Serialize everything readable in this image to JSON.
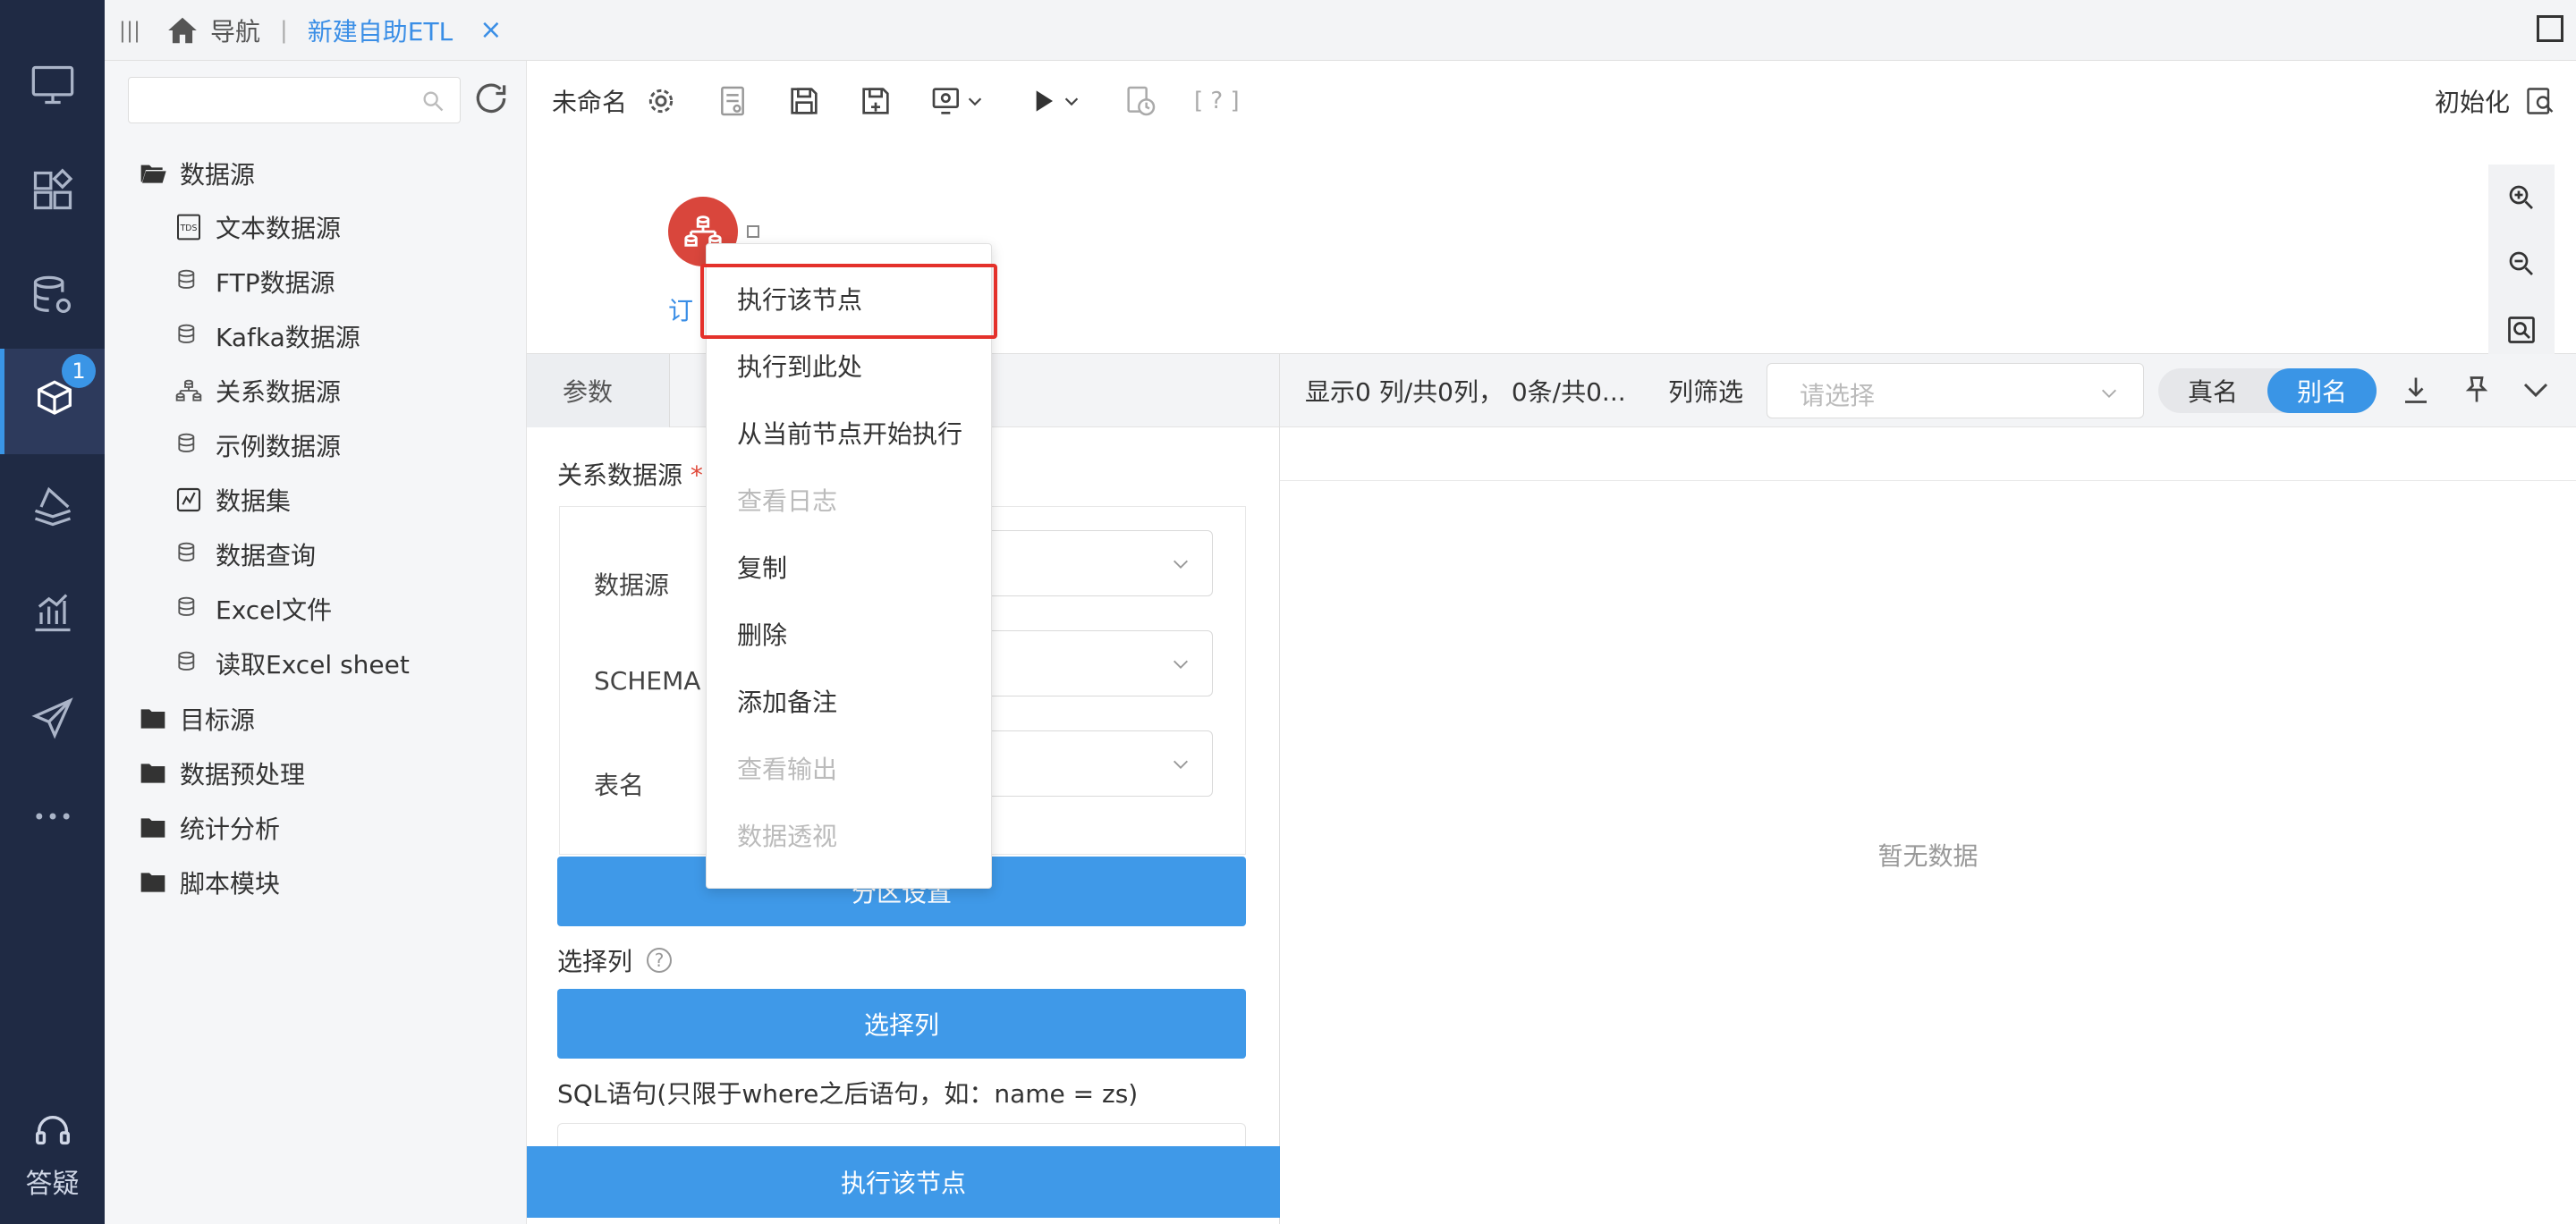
{
  "rail": {
    "badge": "1",
    "help_label": "答疑"
  },
  "tabbar": {
    "home_label": "导航",
    "separator": "|",
    "tab_label": "新建自助ETL",
    "close": "×",
    "menu": "|||"
  },
  "tree": {
    "search_placeholder": "",
    "items": [
      {
        "label": "数据源",
        "icon": "folder-open-icon"
      },
      {
        "label": "文本数据源",
        "icon": "tds-icon"
      },
      {
        "label": "FTP数据源",
        "icon": "database-icon"
      },
      {
        "label": "Kafka数据源",
        "icon": "database-icon"
      },
      {
        "label": "关系数据源",
        "icon": "relation-icon"
      },
      {
        "label": "示例数据源",
        "icon": "database-icon"
      },
      {
        "label": "数据集",
        "icon": "dataset-icon"
      },
      {
        "label": "数据查询",
        "icon": "database-icon"
      },
      {
        "label": "Excel文件",
        "icon": "database-icon"
      },
      {
        "label": "读取Excel sheet",
        "icon": "database-icon"
      },
      {
        "label": "目标源",
        "icon": "folder-icon"
      },
      {
        "label": "数据预处理",
        "icon": "folder-icon"
      },
      {
        "label": "统计分析",
        "icon": "folder-icon"
      },
      {
        "label": "脚本模块",
        "icon": "folder-icon"
      }
    ]
  },
  "toolbar": {
    "name": "未命名",
    "help": "[ ? ]",
    "init_label": "初始化"
  },
  "canvas": {
    "node_label": "订"
  },
  "params": {
    "tab_label": "参数",
    "section_label": "关系数据源",
    "required_mark": "*",
    "fields": [
      "数据源",
      "SCHEMA",
      "表名"
    ],
    "partition_button": "分区设置",
    "select_columns_label": "选择列",
    "select_columns_help": "?",
    "select_columns_button": "选择列",
    "sql_label": "SQL语句(只限于where之后语句，如：name = zs)",
    "run_button": "执行该节点"
  },
  "result": {
    "info": "显示0 列/共0列， 0条/共0...",
    "filter_label": "列筛选",
    "filter_placeholder": "请选择",
    "toggle_real": "真名",
    "toggle_alias": "别名",
    "empty_text": "暂无数据"
  },
  "context_menu": {
    "items": [
      {
        "label": "执行该节点",
        "disabled": false
      },
      {
        "label": "执行到此处",
        "disabled": false
      },
      {
        "label": "从当前节点开始执行",
        "disabled": false
      },
      {
        "label": "查看日志",
        "disabled": true
      },
      {
        "label": "复制",
        "disabled": false
      },
      {
        "label": "删除",
        "disabled": false
      },
      {
        "label": "添加备注",
        "disabled": false
      },
      {
        "label": "查看输出",
        "disabled": true
      },
      {
        "label": "数据透视",
        "disabled": true
      }
    ]
  },
  "colors": {
    "rail_bg": "#1f2a44",
    "accent": "#3a95e6",
    "node_red": "#d9463c",
    "highlight_red": "#e4312b"
  }
}
